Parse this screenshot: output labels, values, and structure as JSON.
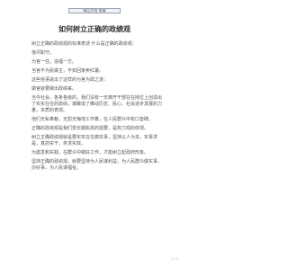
{
  "header": {
    "banner": "精品文档 收藏"
  },
  "document": {
    "title": "如何树立正确的政绩观",
    "paragraphs": [
      "树立正确的政绩观的标准表述 什么是正确的政绩观：",
      "恪尽职守。",
      "为官一任，造福一方。",
      "当官不为民做主，不如回家卖红薯。",
      "这些俗语说出了这样的为官为政之道：",
      "做官就要做出政绩来。",
      "当今社会，各条各级的，我们没有一天离开干部在在岗位上创造出了实实在在的政绩，凝聚成了推动历史、民心、社会进步发展的力量，本质的表现。",
      "他们无私奉献，无怨无悔地工作着，在人民群众中有口皆碑。",
      "正确的政绩观是我们党长期执政的需要，是权力观的体现。",
      "树立正确政绩观就是要实实在在做实事，坚持以人为本，实事求是，真抓实干，务求实效。",
      "为激发和实践，在群众中做好工作，才能树立起政府形象。",
      "坚持正确的政绩观，就要坚持为人民谋利益，为人民群众做实事、办好事，为人民谋福祉。"
    ]
  },
  "footer": {
    "page_number": "1 / 3"
  }
}
